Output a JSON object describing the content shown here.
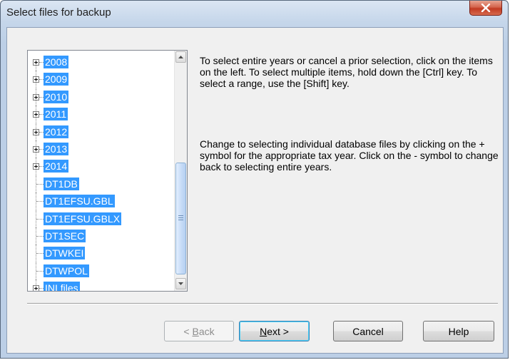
{
  "window": {
    "title": "Select files for backup",
    "close_label": "X"
  },
  "tree": {
    "items": [
      {
        "label": "2008",
        "expandable": true
      },
      {
        "label": "2009",
        "expandable": true
      },
      {
        "label": "2010",
        "expandable": true
      },
      {
        "label": "2011",
        "expandable": true
      },
      {
        "label": "2012",
        "expandable": true
      },
      {
        "label": "2013",
        "expandable": true
      },
      {
        "label": "2014",
        "expandable": true
      },
      {
        "label": "DT1DB",
        "expandable": false
      },
      {
        "label": "DT1EFSU.GBL",
        "expandable": false
      },
      {
        "label": "DT1EFSU.GBLX",
        "expandable": false
      },
      {
        "label": "DT1SEC",
        "expandable": false
      },
      {
        "label": "DTWKEI",
        "expandable": false
      },
      {
        "label": "DTWPOL",
        "expandable": false
      },
      {
        "label": "INI files",
        "expandable": true
      }
    ],
    "selection_color": "#3399ff"
  },
  "instructions": {
    "paragraph1": "To select entire years or cancel a prior selection, click on the items on the left. To select multiple items, hold down the [Ctrl] key. To select a range, use the [Shift] key.",
    "paragraph2": "Change to selecting individual database files by clicking on the + symbol for the appropriate tax year. Click on the - symbol to change back to selecting entire years."
  },
  "buttons": {
    "back": {
      "mnemonic": "B",
      "rest": "ack",
      "prefix": "< ",
      "enabled": false
    },
    "next": {
      "mnemonic": "N",
      "rest": "ext >",
      "enabled": true
    },
    "cancel": {
      "label": "Cancel"
    },
    "help": {
      "label": "Help"
    }
  }
}
